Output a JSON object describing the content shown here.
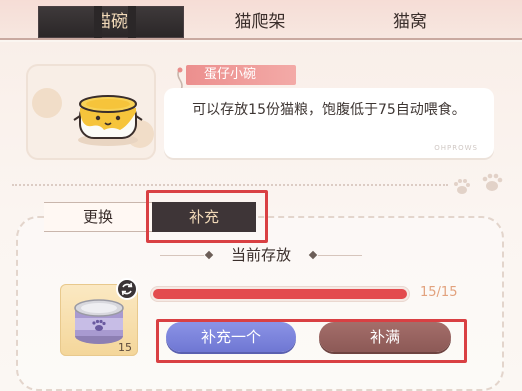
{
  "tabs": [
    {
      "label": "猫碗",
      "active": true
    },
    {
      "label": "猫爬架",
      "active": false
    },
    {
      "label": "猫窝",
      "active": false
    }
  ],
  "item": {
    "name": "蛋仔小碗",
    "description": "可以存放15份猫粮，饱腹低于75自动喂食。",
    "watermark": "OHPROWS"
  },
  "sub_tabs": [
    {
      "label": "更换",
      "active": false
    },
    {
      "label": "补充",
      "active": true
    }
  ],
  "storage": {
    "title": "当前存放",
    "food_count": "15",
    "progress_text": "15/15",
    "progress_fraction": 1.0
  },
  "buttons": {
    "add_one": "补充一个",
    "fill_up": "补满"
  },
  "colors": {
    "accent_red": "#e34b4e",
    "highlight_red": "#d94043",
    "tab_active_bg": "#2a2627",
    "button_blue": "#6f77d3",
    "button_brown": "#8c5956"
  }
}
